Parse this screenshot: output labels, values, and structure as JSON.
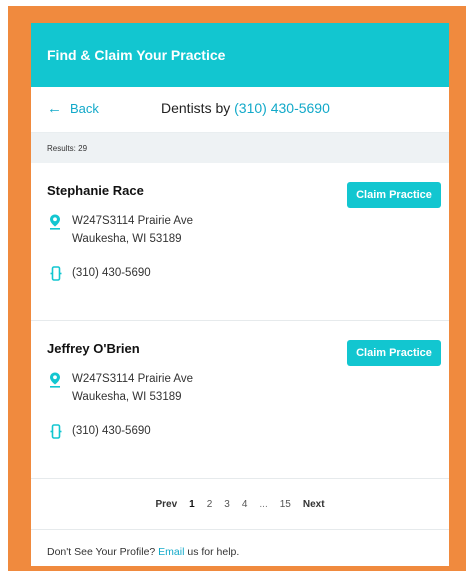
{
  "header": {
    "title": "Find & Claim Your Practice"
  },
  "nav": {
    "back_label": "Back",
    "subtitle_prefix": "Dentists by",
    "subtitle_phone": "(310) 430-5690"
  },
  "results": {
    "label": "Results: 29"
  },
  "listings": [
    {
      "name": "Stephanie Race",
      "claim_label": "Claim Practice",
      "address_line1": "W247S3114 Prairie Ave",
      "address_line2": "Waukesha, WI 53189",
      "phone": "(310) 430-5690"
    },
    {
      "name": "Jeffrey O'Brien",
      "claim_label": "Claim Practice",
      "address_line1": "W247S3114 Prairie Ave",
      "address_line2": "Waukesha, WI 53189",
      "phone": "(310) 430-5690"
    }
  ],
  "pagination": {
    "prev": "Prev",
    "pages": [
      "1",
      "2",
      "3",
      "4"
    ],
    "ellipsis": "...",
    "last": "15",
    "next": "Next",
    "current": "1"
  },
  "footer": {
    "prefix": "Don't See Your Profile?",
    "email_link": "Email",
    "suffix": "us for help."
  },
  "colors": {
    "brand": "#12c6d0",
    "link": "#12a9c9",
    "frame": "#f08a3e"
  },
  "icons": {
    "address": "map-pin-icon",
    "phone": "mobile-phone-icon",
    "back": "arrow-left-icon"
  }
}
